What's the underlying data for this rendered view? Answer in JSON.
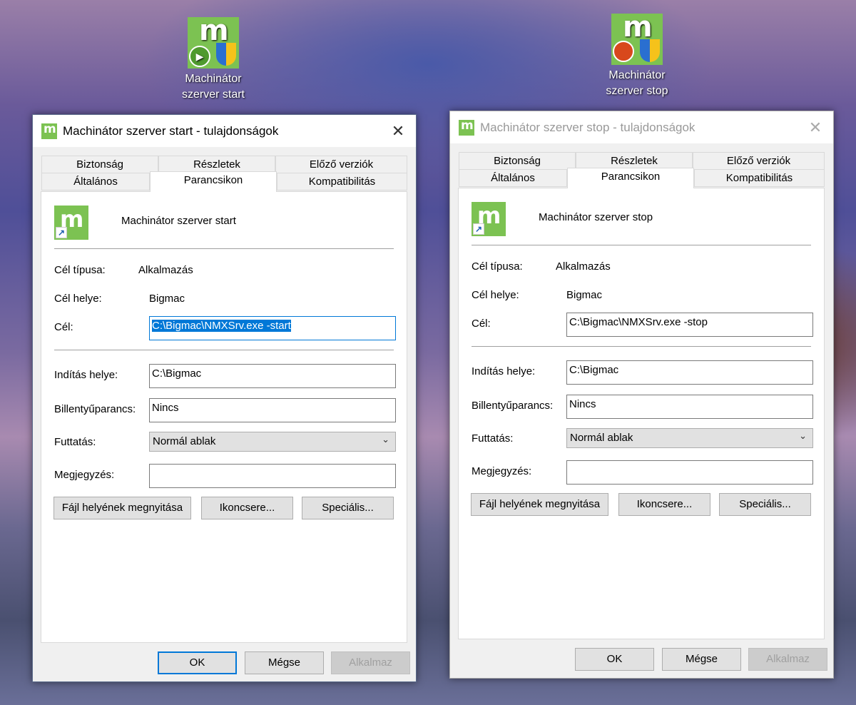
{
  "desktop": {
    "icons": [
      {
        "label_line1": "Machinátor",
        "label_line2": "szerver start"
      },
      {
        "label_line1": "Machinátor",
        "label_line2": "szerver stop"
      }
    ]
  },
  "dialogs": [
    {
      "title": "Machinátor szerver start - tulajdonságok",
      "active": true,
      "tabs_row1": [
        "Biztonság",
        "Részletek",
        "Előző verziók"
      ],
      "tabs_row2": [
        "Általános",
        "Parancsikon",
        "Kompatibilitás"
      ],
      "selected_tab": "Parancsikon",
      "shortcut_name": "Machinátor szerver start",
      "target_type_label": "Cél típusa:",
      "target_type": "Alkalmazás",
      "target_location_label": "Cél helye:",
      "target_location": "Bigmac",
      "target_label": "Cél:",
      "target": "C:\\Bigmac\\NMXSrv.exe -start",
      "start_in_label": "Indítás helye:",
      "start_in": "C:\\Bigmac",
      "hotkey_label": "Billentyűparancs:",
      "hotkey": "Nincs",
      "run_label": "Futtatás:",
      "run": "Normál ablak",
      "comment_label": "Megjegyzés:",
      "comment": "",
      "open_location": "Fájl helyének megnyitása",
      "change_icon": "Ikoncsere...",
      "advanced": "Speciális...",
      "ok": "OK",
      "cancel": "Mégse",
      "apply": "Alkalmaz"
    },
    {
      "title": "Machinátor szerver stop - tulajdonságok",
      "active": false,
      "tabs_row1": [
        "Biztonság",
        "Részletek",
        "Előző verziók"
      ],
      "tabs_row2": [
        "Általános",
        "Parancsikon",
        "Kompatibilitás"
      ],
      "selected_tab": "Parancsikon",
      "shortcut_name": "Machinátor szerver stop",
      "target_type_label": "Cél típusa:",
      "target_type": "Alkalmazás",
      "target_location_label": "Cél helye:",
      "target_location": "Bigmac",
      "target_label": "Cél:",
      "target": "C:\\Bigmac\\NMXSrv.exe -stop",
      "start_in_label": "Indítás helye:",
      "start_in": "C:\\Bigmac",
      "hotkey_label": "Billentyűparancs:",
      "hotkey": "Nincs",
      "run_label": "Futtatás:",
      "run": "Normál ablak",
      "comment_label": "Megjegyzés:",
      "comment": "",
      "open_location": "Fájl helyének megnyitása",
      "change_icon": "Ikoncsere...",
      "advanced": "Speciális...",
      "ok": "OK",
      "cancel": "Mégse",
      "apply": "Alkalmaz"
    }
  ]
}
